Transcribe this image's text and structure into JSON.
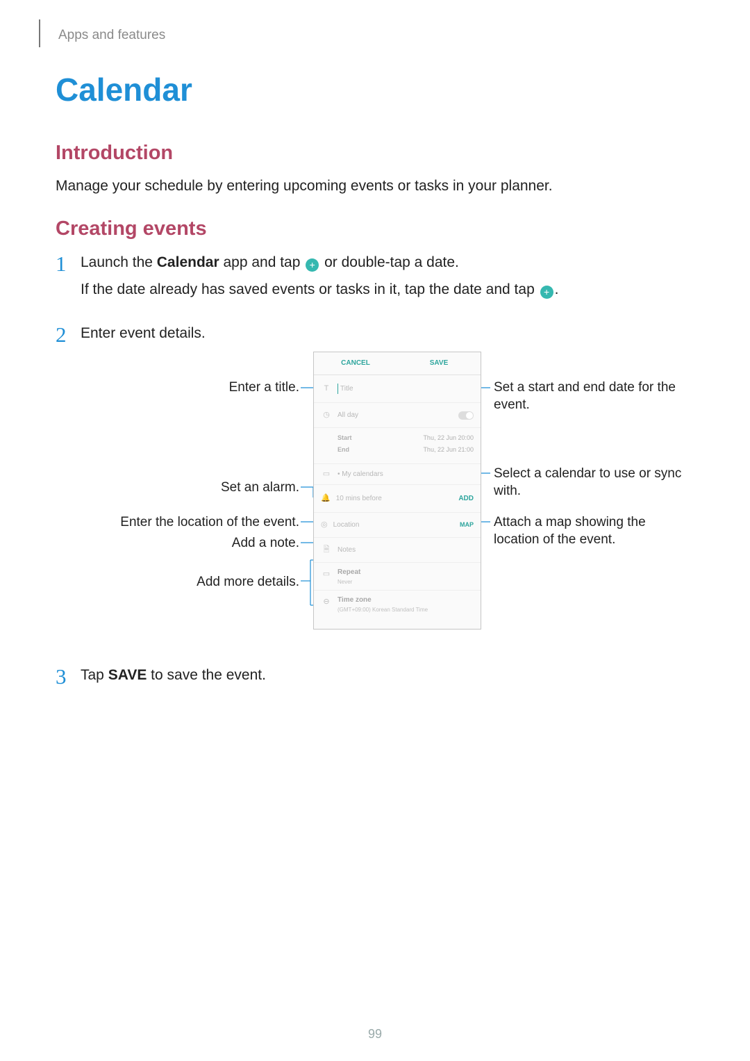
{
  "breadcrumb": "Apps and features",
  "page_title": "Calendar",
  "sections": {
    "intro_heading": "Introduction",
    "intro_body": "Manage your schedule by entering upcoming events or tasks in your planner.",
    "create_heading": "Creating events"
  },
  "steps": [
    {
      "num": "1",
      "main_pre": "Launch the ",
      "main_bold": "Calendar",
      "main_mid": " app and tap ",
      "main_post": " or double-tap a date.",
      "sub_pre": "If the date already has saved events or tasks in it, tap the date and tap ",
      "sub_post": "."
    },
    {
      "num": "2",
      "main": "Enter event details."
    },
    {
      "num": "3",
      "main_pre": "Tap ",
      "main_bold": "SAVE",
      "main_post": " to save the event."
    }
  ],
  "plus_glyph": "+",
  "phone": {
    "cancel": "CANCEL",
    "save": "SAVE",
    "title_icon": "T",
    "title_placeholder": "Title",
    "clock_icon": "◷",
    "all_day": "All day",
    "start_label": "Start",
    "start_value": "Thu, 22 Jun   20:00",
    "end_label": "End",
    "end_value": "Thu, 22 Jun   21:00",
    "cal_icon": "▭",
    "my_calendars": "• My calendars",
    "bell_icon": "🔔",
    "alarm_text": "10 mins before",
    "alarm_add": "ADD",
    "pin_icon": "◎",
    "location": "Location",
    "map": "MAP",
    "note_icon": "🗎",
    "notes": "Notes",
    "repeat_icon": "▭",
    "repeat": "Repeat",
    "repeat_val": "Never",
    "tz_icon": "⊖",
    "tz": "Time zone",
    "tz_val": "(GMT+09:00) Korean Standard Time"
  },
  "callouts": {
    "left": {
      "title": "Enter a title.",
      "alarm": "Set an alarm.",
      "location": "Enter the location of the event.",
      "note": "Add a note.",
      "more": "Add more details."
    },
    "right": {
      "dates": "Set a start and end date for the event.",
      "calendar": "Select a calendar to use or sync with.",
      "map": "Attach a map showing the location of the event."
    }
  },
  "page_number": "99"
}
